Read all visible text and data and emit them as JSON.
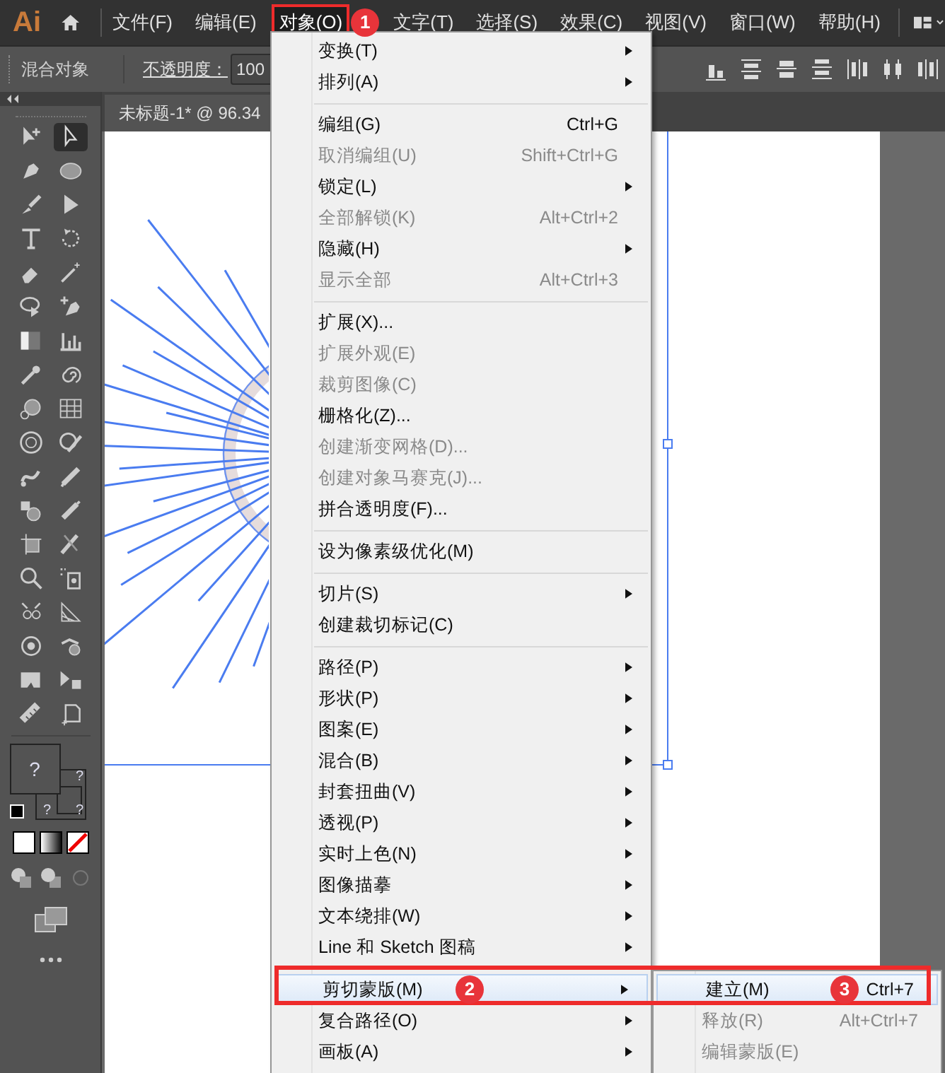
{
  "app_logo": "Ai",
  "menubar": [
    {
      "label": "文件(F)",
      "selected": false
    },
    {
      "label": "编辑(E)",
      "selected": false
    },
    {
      "label": "对象(O)",
      "selected": true,
      "badge": "1"
    },
    {
      "label": "文字(T)",
      "selected": false
    },
    {
      "label": "选择(S)",
      "selected": false
    },
    {
      "label": "效果(C)",
      "selected": false
    },
    {
      "label": "视图(V)",
      "selected": false
    },
    {
      "label": "窗口(W)",
      "selected": false
    },
    {
      "label": "帮助(H)",
      "selected": false
    }
  ],
  "control_bar": {
    "object_type": "混合对象",
    "opacity_label": "不透明度：",
    "opacity_value": "100"
  },
  "fill_stroke": {
    "fill_mark": "?",
    "stroke_marks": [
      "?",
      "?",
      "?"
    ]
  },
  "document_tab": {
    "title": "未标题-1* @ 96.34"
  },
  "menu": {
    "items": [
      {
        "kind": "item",
        "label": "变换(T)",
        "submenu": true,
        "disabled": false,
        "selected": false
      },
      {
        "kind": "item",
        "label": "排列(A)",
        "submenu": true,
        "disabled": false,
        "selected": false
      },
      {
        "kind": "separator"
      },
      {
        "kind": "item",
        "label": "编组(G)",
        "shortcut": "Ctrl+G",
        "submenu": false,
        "disabled": false,
        "selected": false
      },
      {
        "kind": "item",
        "label": "取消编组(U)",
        "shortcut": "Shift+Ctrl+G",
        "submenu": false,
        "disabled": true,
        "selected": false
      },
      {
        "kind": "item",
        "label": "锁定(L)",
        "submenu": true,
        "disabled": false,
        "selected": false
      },
      {
        "kind": "item",
        "label": "全部解锁(K)",
        "shortcut": "Alt+Ctrl+2",
        "submenu": false,
        "disabled": true,
        "selected": false
      },
      {
        "kind": "item",
        "label": "隐藏(H)",
        "submenu": true,
        "disabled": false,
        "selected": false
      },
      {
        "kind": "item",
        "label": "显示全部",
        "shortcut": "Alt+Ctrl+3",
        "submenu": false,
        "disabled": true,
        "selected": false
      },
      {
        "kind": "separator"
      },
      {
        "kind": "item",
        "label": "扩展(X)...",
        "submenu": false,
        "disabled": false,
        "selected": false
      },
      {
        "kind": "item",
        "label": "扩展外观(E)",
        "submenu": false,
        "disabled": true,
        "selected": false
      },
      {
        "kind": "item",
        "label": "裁剪图像(C)",
        "submenu": false,
        "disabled": true,
        "selected": false
      },
      {
        "kind": "item",
        "label": "栅格化(Z)...",
        "submenu": false,
        "disabled": false,
        "selected": false
      },
      {
        "kind": "item",
        "label": "创建渐变网格(D)...",
        "submenu": false,
        "disabled": true,
        "selected": false
      },
      {
        "kind": "item",
        "label": "创建对象马赛克(J)...",
        "submenu": false,
        "disabled": true,
        "selected": false
      },
      {
        "kind": "item",
        "label": "拼合透明度(F)...",
        "submenu": false,
        "disabled": false,
        "selected": false
      },
      {
        "kind": "separator"
      },
      {
        "kind": "item",
        "label": "设为像素级优化(M)",
        "submenu": false,
        "disabled": false,
        "selected": false
      },
      {
        "kind": "separator"
      },
      {
        "kind": "item",
        "label": "切片(S)",
        "submenu": true,
        "disabled": false,
        "selected": false
      },
      {
        "kind": "item",
        "label": "创建裁切标记(C)",
        "submenu": false,
        "disabled": false,
        "selected": false
      },
      {
        "kind": "separator"
      },
      {
        "kind": "item",
        "label": "路径(P)",
        "submenu": true,
        "disabled": false,
        "selected": false
      },
      {
        "kind": "item",
        "label": "形状(P)",
        "submenu": true,
        "disabled": false,
        "selected": false
      },
      {
        "kind": "item",
        "label": "图案(E)",
        "submenu": true,
        "disabled": false,
        "selected": false
      },
      {
        "kind": "item",
        "label": "混合(B)",
        "submenu": true,
        "disabled": false,
        "selected": false
      },
      {
        "kind": "item",
        "label": "封套扭曲(V)",
        "submenu": true,
        "disabled": false,
        "selected": false
      },
      {
        "kind": "item",
        "label": "透视(P)",
        "submenu": true,
        "disabled": false,
        "selected": false
      },
      {
        "kind": "item",
        "label": "实时上色(N)",
        "submenu": true,
        "disabled": false,
        "selected": false
      },
      {
        "kind": "item",
        "label": "图像描摹",
        "submenu": true,
        "disabled": false,
        "selected": false
      },
      {
        "kind": "item",
        "label": "文本绕排(W)",
        "submenu": true,
        "disabled": false,
        "selected": false
      },
      {
        "kind": "item",
        "label": "Line 和 Sketch 图稿",
        "submenu": true,
        "disabled": false,
        "selected": false
      },
      {
        "kind": "separator"
      },
      {
        "kind": "item",
        "label": "剪切蒙版(M)",
        "submenu": true,
        "disabled": false,
        "selected": true,
        "badge": "2"
      },
      {
        "kind": "item",
        "label": "复合路径(O)",
        "submenu": true,
        "disabled": false,
        "selected": false
      },
      {
        "kind": "item",
        "label": "画板(A)",
        "submenu": true,
        "disabled": false,
        "selected": false
      }
    ]
  },
  "submenu": {
    "items": [
      {
        "label": "建立(M)",
        "shortcut": "Ctrl+7",
        "disabled": false,
        "selected": true,
        "badge": "3"
      },
      {
        "label": "释放(R)",
        "shortcut": "Alt+Ctrl+7",
        "disabled": true,
        "selected": false
      },
      {
        "label": "编辑蒙版(E)",
        "disabled": true,
        "selected": false
      }
    ]
  }
}
